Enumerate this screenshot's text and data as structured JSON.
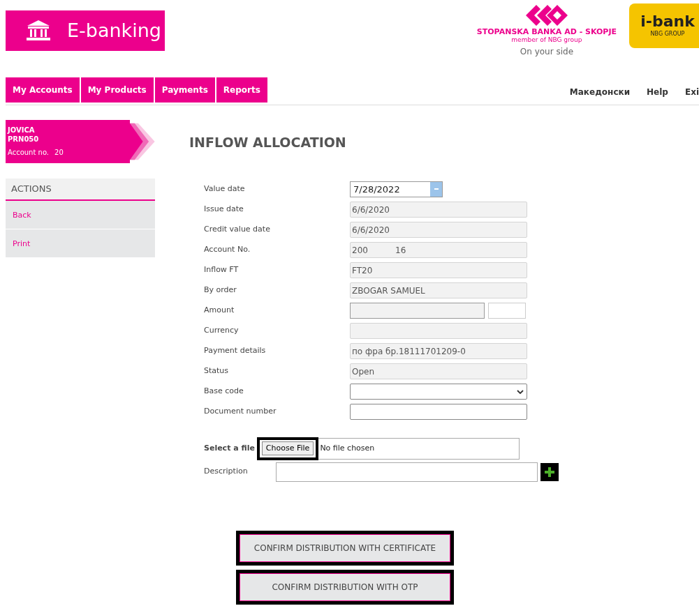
{
  "brand": {
    "title": "E-banking",
    "bank_name": "STOPANSKA BANKA AD - SKOPJE",
    "bank_member": "member of NBG group",
    "slogan": "On your side",
    "ibank": "i-bank",
    "ibank_sub": "NBG GROUP"
  },
  "nav": [
    "My Accounts",
    "My Products",
    "Payments",
    "Reports"
  ],
  "top_links": [
    "Македонски",
    "Help",
    "Exi"
  ],
  "customer": {
    "name": "JOVICA",
    "id": "PRN050",
    "account_label": "Account no.",
    "account": "20"
  },
  "actions": {
    "title": "ACTIONS",
    "items": [
      "Back",
      "Print"
    ]
  },
  "page_title": "INFLOW ALLOCATION",
  "fields": [
    {
      "kind": "date",
      "label": "Value date",
      "value": "7/28/2022"
    },
    {
      "kind": "readonly",
      "label": "Issue date",
      "value": "6/6/2020"
    },
    {
      "kind": "readonly",
      "label": "Credit value date",
      "value": "6/6/2020"
    },
    {
      "kind": "split",
      "label": "Account No.",
      "value": "200",
      "value_end": "16"
    },
    {
      "kind": "readonly",
      "label": "Inflow FT",
      "value": "FT20"
    },
    {
      "kind": "readonly",
      "label": "By order",
      "value": "ZBOGAR SAMUEL"
    },
    {
      "kind": "amount",
      "label": "Amount"
    },
    {
      "kind": "readonly",
      "label": "Currency"
    },
    {
      "kind": "readonly",
      "label": "Payment details",
      "value": "по фра бр.18111701209-0"
    },
    {
      "kind": "readonly",
      "label": "Status",
      "value": "Open"
    },
    {
      "kind": "select",
      "label": "Base code"
    },
    {
      "kind": "input",
      "label": "Document number"
    }
  ],
  "file": {
    "label": "Select a file",
    "button": "Choose File",
    "status": "No file chosen"
  },
  "description": {
    "label": "Description"
  },
  "buttons": [
    "CONFIRM DISTRIBUTION WITH CERTIFICATE",
    "CONFIRM DISTRIBUTION WITH OTP"
  ]
}
